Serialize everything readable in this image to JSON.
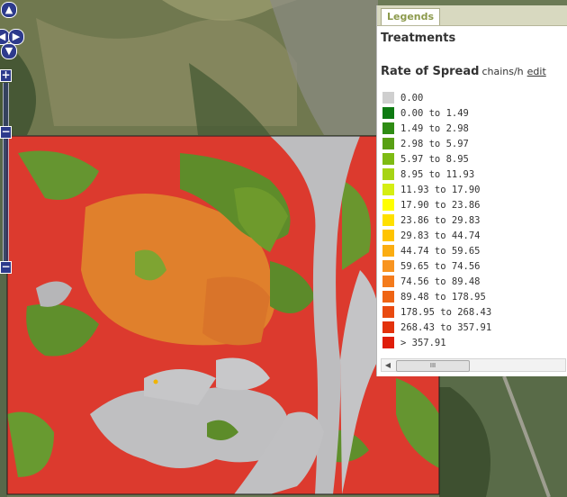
{
  "legend": {
    "tab_label": "Legends",
    "section_title": "Treatments",
    "ros_title": "Rate of Spread",
    "ros_unit": "chains/h",
    "edit_label": "edit",
    "scroll_grip": "III",
    "items": [
      {
        "label": "0.00",
        "color": "#cfcfcf"
      },
      {
        "label": "0.00 to 1.49",
        "color": "#0e7a12"
      },
      {
        "label": "1.49 to 2.98",
        "color": "#2f8c14"
      },
      {
        "label": "2.98 to 5.97",
        "color": "#58a014"
      },
      {
        "label": "5.97 to 8.95",
        "color": "#7ebb14"
      },
      {
        "label": "8.95 to 11.93",
        "color": "#a6d414"
      },
      {
        "label": "11.93 to 17.90",
        "color": "#d5ee14"
      },
      {
        "label": "17.90 to 23.86",
        "color": "#ffff00"
      },
      {
        "label": "23.86 to 29.83",
        "color": "#ffe000"
      },
      {
        "label": "29.83 to 44.74",
        "color": "#ffc400"
      },
      {
        "label": "44.74 to 59.65",
        "color": "#fbad12"
      },
      {
        "label": "59.65 to 74.56",
        "color": "#f89420"
      },
      {
        "label": "74.56 to 89.48",
        "color": "#f47b1c"
      },
      {
        "label": "89.48 to 178.95",
        "color": "#ef6414"
      },
      {
        "label": "178.95 to 268.43",
        "color": "#e94a10"
      },
      {
        "label": "268.43 to 357.91",
        "color": "#e3320c"
      },
      {
        "label": "> 357.91",
        "color": "#df1d0a"
      }
    ]
  },
  "map_controls": {
    "pan_up": "▲",
    "pan_left": "◀",
    "pan_right": "▶",
    "pan_down": "▼",
    "zoom_in": "+",
    "zoom_out": "−"
  }
}
